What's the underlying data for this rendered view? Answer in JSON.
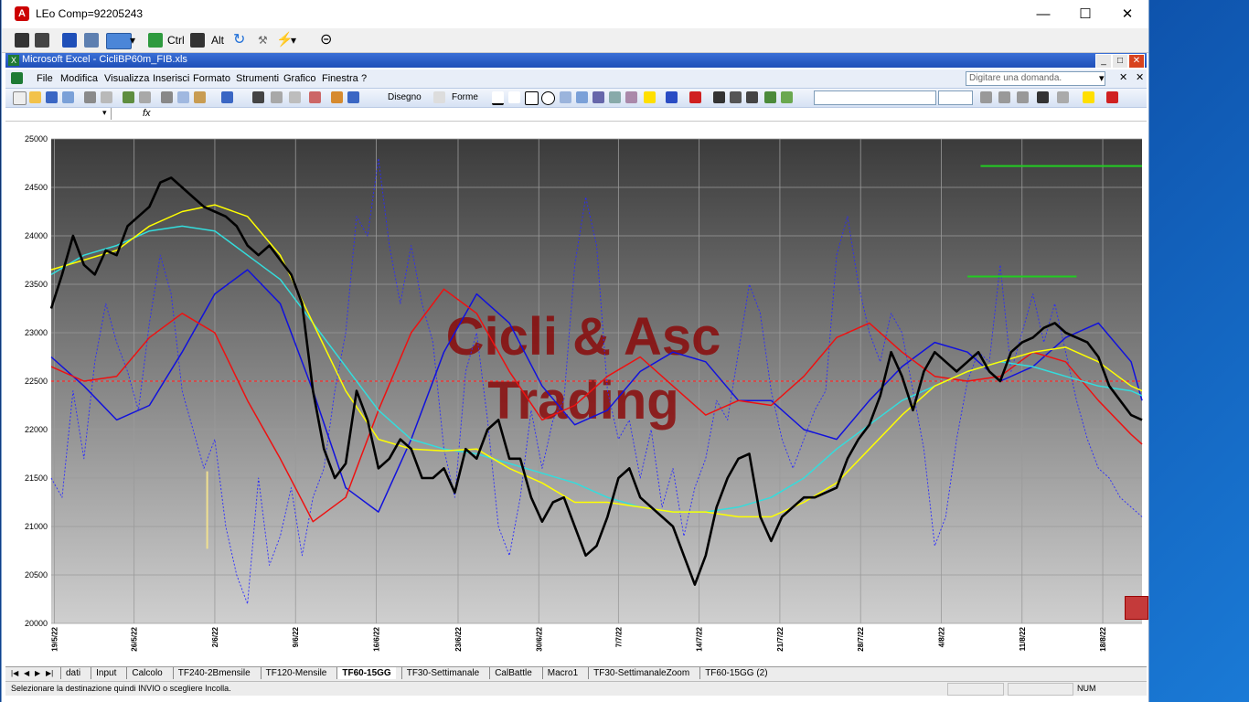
{
  "window": {
    "title": "LEo Comp=92205243",
    "app_badge": "A"
  },
  "leo_toolbar": {
    "ctrl": "Ctrl",
    "alt": "Alt"
  },
  "excel": {
    "title": "Microsoft Excel - CicliBP60m_FIB.xls",
    "menus": [
      "File",
      "Modifica",
      "Visualizza",
      "Inserisci",
      "Formato",
      "Strumenti",
      "Grafico",
      "Finestra",
      "?"
    ],
    "ask_placeholder": "Digitare una domanda.",
    "draw_label": "Disegno",
    "shapes_label": "Forme",
    "fx": "fx"
  },
  "sheet_tabs": [
    "dati",
    "Input",
    "Calcolo",
    "TF240-2Bmensile",
    "TF120-Mensile",
    "TF60-15GG",
    "TF30-Settimanale",
    "CalBattle",
    "Macro1",
    "TF30-SettimanaleZoom",
    "TF60-15GG (2)"
  ],
  "active_tab": "TF60-15GG",
  "status": {
    "message": "Selezionare la destinazione quindi INVIO o scegliere Incolla.",
    "num": "NUM"
  },
  "chart_data": {
    "type": "line",
    "watermark": [
      "Cicli & Asc",
      "Trading"
    ],
    "ylim": [
      20000,
      25000
    ],
    "yticks": [
      20000,
      20500,
      21000,
      21500,
      22000,
      22500,
      23000,
      23500,
      24000,
      24500,
      25000
    ],
    "xlim": [
      0,
      100
    ],
    "x_tick_labels": [
      {
        "label": "19/5/22",
        "x": 0.3
      },
      {
        "label": "26/5/22",
        "x": 7.6
      },
      {
        "label": "2/6/22",
        "x": 15.0
      },
      {
        "label": "9/6/22",
        "x": 22.4
      },
      {
        "label": "16/6/22",
        "x": 29.8
      },
      {
        "label": "23/6/22",
        "x": 37.3
      },
      {
        "label": "30/6/22",
        "x": 44.7
      },
      {
        "label": "7/7/22",
        "x": 52.0
      },
      {
        "label": "14/7/22",
        "x": 59.4
      },
      {
        "label": "21/7/22",
        "x": 66.8
      },
      {
        "label": "28/7/22",
        "x": 74.2
      },
      {
        "label": "4/8/22",
        "x": 81.6
      },
      {
        "label": "11/8/22",
        "x": 89.0
      },
      {
        "label": "18/8/22",
        "x": 96.4
      }
    ],
    "reference_line": {
      "y": 22500,
      "color": "#ff2a2a"
    },
    "levels": [
      {
        "x": [
          85.2,
          100
        ],
        "y": 24720,
        "color": "#22cc22"
      },
      {
        "x": [
          84.0,
          94.0
        ],
        "y": 23580,
        "color": "#22cc22"
      },
      {
        "x": [
          14.3,
          14.3
        ],
        "y": [
          20770,
          21570
        ],
        "color": "#f0e090"
      }
    ],
    "series": [
      {
        "color": "#000000",
        "width": 2.6,
        "x": [
          0,
          1,
          2,
          3,
          4,
          5,
          6,
          7,
          8,
          9,
          10,
          11,
          12,
          13,
          14,
          15,
          16,
          17,
          18,
          19,
          20,
          21,
          22,
          23,
          24,
          25,
          26,
          27,
          28,
          29,
          30,
          31,
          32,
          33,
          34,
          35,
          36,
          37,
          38,
          39,
          40,
          41,
          42,
          43,
          44,
          45,
          46,
          47,
          48,
          49,
          50,
          51,
          52,
          53,
          54,
          55,
          56,
          57,
          58,
          59,
          60,
          61,
          62,
          63,
          64,
          65,
          66,
          67,
          68,
          69,
          70,
          71,
          72,
          73,
          74,
          75,
          76,
          77,
          78,
          79,
          80,
          81,
          82,
          83,
          84,
          85,
          86,
          87,
          88,
          89,
          90,
          91,
          92,
          93,
          94,
          95,
          96,
          97,
          98,
          99,
          100
        ],
        "y": [
          23250,
          23600,
          24000,
          23700,
          23600,
          23850,
          23800,
          24100,
          24200,
          24300,
          24550,
          24600,
          24500,
          24400,
          24300,
          24250,
          24200,
          24100,
          23900,
          23800,
          23900,
          23750,
          23600,
          23300,
          22400,
          21800,
          21500,
          21650,
          22400,
          22100,
          21600,
          21700,
          21900,
          21800,
          21500,
          21500,
          21600,
          21350,
          21800,
          21700,
          22000,
          22100,
          21700,
          21700,
          21300,
          21050,
          21250,
          21300,
          21000,
          20700,
          20800,
          21100,
          21500,
          21600,
          21300,
          21200,
          21100,
          21000,
          20700,
          20400,
          20700,
          21200,
          21500,
          21700,
          21750,
          21100,
          20850,
          21100,
          21200,
          21300,
          21300,
          21350,
          21400,
          21700,
          21900,
          22050,
          22350,
          22800,
          22550,
          22200,
          22600,
          22800,
          22700,
          22600,
          22700,
          22800,
          22600,
          22500,
          22800,
          22900,
          22950,
          23050,
          23100,
          23000,
          22950,
          22900,
          22750,
          22450,
          22300,
          22150,
          22100
        ]
      },
      {
        "color": "#ffff00",
        "width": 1.5,
        "x": [
          0,
          3,
          6,
          9,
          12,
          15,
          18,
          21,
          24,
          27,
          30,
          33,
          36,
          39,
          42,
          45,
          48,
          51,
          54,
          57,
          60,
          63,
          66,
          69,
          72,
          75,
          78,
          81,
          84,
          87,
          90,
          93,
          96,
          99,
          100
        ],
        "y": [
          23650,
          23750,
          23850,
          24100,
          24250,
          24320,
          24200,
          23800,
          23100,
          22400,
          21900,
          21800,
          21780,
          21800,
          21600,
          21450,
          21250,
          21250,
          21200,
          21150,
          21150,
          21100,
          21100,
          21250,
          21450,
          21800,
          22150,
          22450,
          22600,
          22700,
          22800,
          22850,
          22700,
          22450,
          22400
        ]
      },
      {
        "color": "#33dddd",
        "width": 1.5,
        "x": [
          0,
          3,
          6,
          9,
          12,
          15,
          18,
          21,
          24,
          27,
          30,
          33,
          36,
          39,
          42,
          45,
          48,
          51,
          54,
          57,
          60,
          63,
          66,
          69,
          72,
          75,
          78,
          81,
          84,
          87,
          90,
          93,
          96,
          99,
          100
        ],
        "y": [
          23600,
          23800,
          23900,
          24050,
          24100,
          24050,
          23800,
          23550,
          23100,
          22650,
          22200,
          21900,
          21800,
          21750,
          21650,
          21550,
          21450,
          21300,
          21200,
          21150,
          21150,
          21200,
          21300,
          21500,
          21800,
          22050,
          22300,
          22450,
          22600,
          22700,
          22650,
          22550,
          22450,
          22400,
          22350
        ]
      },
      {
        "color": "#ee1111",
        "width": 1.5,
        "x": [
          0,
          3,
          6,
          9,
          12,
          15,
          18,
          21,
          24,
          27,
          30,
          33,
          36,
          39,
          42,
          45,
          48,
          51,
          54,
          57,
          60,
          63,
          66,
          69,
          72,
          75,
          78,
          81,
          84,
          87,
          90,
          93,
          96,
          99,
          100
        ],
        "y": [
          22650,
          22500,
          22550,
          22950,
          23200,
          23000,
          22300,
          21700,
          21050,
          21300,
          22200,
          23000,
          23450,
          23200,
          22600,
          22100,
          22250,
          22550,
          22750,
          22450,
          22150,
          22300,
          22250,
          22550,
          22950,
          23100,
          22800,
          22550,
          22500,
          22550,
          22800,
          22700,
          22300,
          21950,
          21850
        ]
      },
      {
        "color": "#1111dd",
        "width": 1.5,
        "x": [
          0,
          3,
          6,
          9,
          12,
          15,
          18,
          21,
          24,
          27,
          30,
          33,
          36,
          39,
          42,
          45,
          48,
          51,
          54,
          57,
          60,
          63,
          66,
          69,
          72,
          75,
          78,
          81,
          84,
          87,
          90,
          93,
          96,
          99,
          100
        ],
        "y": [
          22750,
          22450,
          22100,
          22250,
          22800,
          23400,
          23650,
          23300,
          22400,
          21400,
          21150,
          21900,
          22800,
          23400,
          23100,
          22450,
          22050,
          22200,
          22600,
          22800,
          22700,
          22300,
          22300,
          22000,
          21900,
          22300,
          22650,
          22900,
          22800,
          22500,
          22650,
          22950,
          23100,
          22700,
          22300
        ]
      },
      {
        "color": "#2a2aff",
        "width": 0.9,
        "dash": "2,2",
        "x": [
          0,
          1,
          2,
          3,
          4,
          5,
          6,
          7,
          8,
          9,
          10,
          11,
          12,
          13,
          14,
          15,
          16,
          17,
          18,
          19,
          20,
          21,
          22,
          23,
          24,
          25,
          26,
          27,
          28,
          29,
          30,
          31,
          32,
          33,
          34,
          35,
          36,
          37,
          38,
          39,
          40,
          41,
          42,
          43,
          44,
          45,
          46,
          47,
          48,
          49,
          50,
          51,
          52,
          53,
          54,
          55,
          56,
          57,
          58,
          59,
          60,
          61,
          62,
          63,
          64,
          65,
          66,
          67,
          68,
          69,
          70,
          71,
          72,
          73,
          74,
          75,
          76,
          77,
          78,
          79,
          80,
          81,
          82,
          83,
          84,
          85,
          86,
          87,
          88,
          89,
          90,
          91,
          92,
          93,
          94,
          95,
          96,
          97,
          98,
          99,
          100
        ],
        "y": [
          21500,
          21300,
          22400,
          21700,
          22700,
          23300,
          22900,
          22600,
          22200,
          23100,
          23800,
          23400,
          22400,
          22000,
          21600,
          21900,
          21000,
          20500,
          20200,
          21500,
          20600,
          20900,
          21400,
          20700,
          21300,
          21600,
          22400,
          23000,
          24200,
          24000,
          24800,
          23900,
          23300,
          23900,
          23300,
          22900,
          21800,
          21300,
          22600,
          23000,
          22100,
          21000,
          20700,
          21300,
          22200,
          21600,
          22100,
          22300,
          23700,
          24400,
          23900,
          22400,
          21900,
          22100,
          21500,
          22000,
          21200,
          21600,
          20900,
          21400,
          21700,
          22300,
          22100,
          22800,
          23500,
          23200,
          22400,
          21900,
          21600,
          21900,
          22200,
          22400,
          23800,
          24200,
          23500,
          23000,
          22700,
          23200,
          23000,
          22400,
          21800,
          20800,
          21100,
          21900,
          22500,
          22800,
          22700,
          23700,
          22600,
          23000,
          23400,
          22900,
          23300,
          22800,
          22300,
          21900,
          21600,
          21500,
          21300,
          21200,
          21100
        ]
      }
    ]
  }
}
